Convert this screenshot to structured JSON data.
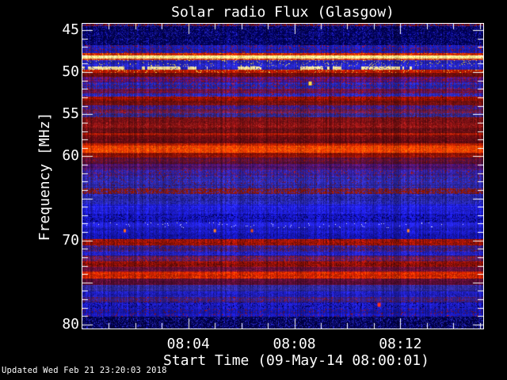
{
  "window": {
    "background": "#000000",
    "text_color": "#ffffff"
  },
  "chart_data": {
    "type": "heatmap",
    "subtype": "radio-spectrogram",
    "title": "Solar radio Flux (Glasgow)",
    "xlabel": "Start Time (09-May-14 08:00:01)",
    "ylabel": "Frequency [MHz]",
    "footer": "Updated Wed Feb 21 23:20:03 2018",
    "axis_color": "#ffffff",
    "background_color": "#000000",
    "x_range_minutes": [
      0,
      15.13
    ],
    "x_major_ticks": [
      {
        "minute": 4,
        "label": "08:04"
      },
      {
        "minute": 8,
        "label": "08:08"
      },
      {
        "minute": 12,
        "label": "08:12"
      }
    ],
    "x_minor_tick_every_minutes": 1,
    "y_range_mhz": [
      44.25,
      80.47
    ],
    "y_major_ticks": [
      {
        "mhz": 45,
        "label": "45"
      },
      {
        "mhz": 50,
        "label": "50"
      },
      {
        "mhz": 55,
        "label": "55"
      },
      {
        "mhz": 60,
        "label": "60"
      },
      {
        "mhz": 70,
        "label": "70"
      },
      {
        "mhz": 80,
        "label": "80"
      }
    ],
    "y_tick_marks_every_mhz": 1,
    "y_major_tick_every_mhz": 5,
    "bands_format": [
      "f0_mhz",
      "f1_mhz",
      "base_color",
      "fleck_color",
      "fleck_density",
      "optional_blocks_flag"
    ],
    "bands": [
      [
        44.25,
        44.55,
        "#7a1010",
        "#2a2a96",
        0.45
      ],
      [
        44.55,
        46.8,
        "#000050",
        "#1a1aa0",
        0.28
      ],
      [
        46.8,
        47.75,
        "#1d1db4",
        "#a01010",
        0.12
      ],
      [
        47.75,
        48.0,
        "#c32000",
        "#ff8000",
        0.15
      ],
      [
        48.0,
        48.35,
        "#fff2a0",
        "#ffc850",
        0.25
      ],
      [
        48.35,
        48.6,
        "#b42810",
        "#e08030",
        0.3
      ],
      [
        48.6,
        49.35,
        "#2424be",
        "#f0d040",
        0.06
      ],
      [
        49.35,
        49.75,
        "#2424be",
        "#f5e09a",
        0.0,
        "blocks"
      ],
      [
        49.75,
        50.1,
        "#bc1a00",
        "#ffd040",
        0.08
      ],
      [
        50.1,
        50.6,
        "#6e0c0c",
        "#8c1414",
        0.2
      ],
      [
        50.6,
        51.2,
        "#4a1482",
        "#a01010",
        0.2
      ],
      [
        51.2,
        52.0,
        "#2626b4",
        "#a81010",
        0.15
      ],
      [
        52.0,
        52.5,
        "#5a1456",
        "#8c1010",
        0.2
      ],
      [
        52.5,
        52.9,
        "#2a2ac0",
        "#901010",
        0.1
      ],
      [
        52.9,
        53.4,
        "#a81200",
        "#700808",
        0.2
      ],
      [
        53.4,
        53.9,
        "#6e0e0e",
        "#8c1818",
        0.2
      ],
      [
        53.9,
        54.4,
        "#381c92",
        "#8c1414",
        0.15
      ],
      [
        54.4,
        54.9,
        "#5a1e5a",
        "#a01414",
        0.2
      ],
      [
        54.9,
        55.35,
        "#2e2894",
        "#781414",
        0.15
      ],
      [
        55.35,
        56.1,
        "#700d12",
        "#8c1818",
        0.3
      ],
      [
        56.1,
        56.65,
        "#871010",
        "#a82020",
        0.3
      ],
      [
        56.65,
        57.2,
        "#640d12",
        "#801418",
        0.25
      ],
      [
        57.2,
        57.5,
        "#aa1604",
        "#c42810",
        0.2
      ],
      [
        57.5,
        57.9,
        "#700b10",
        "#8c1414",
        0.2
      ],
      [
        57.9,
        58.45,
        "#5c0a10",
        "#781018",
        0.2
      ],
      [
        58.45,
        58.75,
        "#b61c00",
        "#d43000",
        0.2
      ],
      [
        58.75,
        59.6,
        "#ee3800",
        "#ff6400",
        0.25
      ],
      [
        59.6,
        60.15,
        "#8e1004",
        "#a82010",
        0.2
      ],
      [
        60.15,
        60.9,
        "#55103c",
        "#801010",
        0.2
      ],
      [
        60.9,
        61.55,
        "#461270",
        "#6e1450",
        0.2
      ],
      [
        61.55,
        62.4,
        "#32209b",
        "#901414",
        0.12
      ],
      [
        62.4,
        63.8,
        "#2c28a8",
        "#781010",
        0.08
      ],
      [
        63.8,
        64.5,
        "#8c1608",
        "#3a2a9e",
        0.35
      ],
      [
        64.5,
        65.7,
        "#2a2ab0",
        "#14148c",
        0.2
      ],
      [
        65.7,
        66.8,
        "#1d1dd8",
        "#3030ff",
        0.15
      ],
      [
        66.8,
        67.9,
        "#1818c4",
        "#000060",
        0.2
      ],
      [
        67.9,
        68.5,
        "#2020cc",
        "#d8d8ff",
        0.02
      ],
      [
        68.5,
        69.2,
        "#1b1bc4",
        "#12129a",
        0.2
      ],
      [
        69.2,
        69.85,
        "#1717ba",
        "#0d0d8c",
        0.2
      ],
      [
        69.85,
        70.6,
        "#aa1606",
        "#6e0c0c",
        0.25
      ],
      [
        70.6,
        71.35,
        "#351f90",
        "#781010",
        0.12
      ],
      [
        71.35,
        71.8,
        "#2222c0",
        "#14149a",
        0.15
      ],
      [
        71.8,
        72.45,
        "#521a5e",
        "#a01616",
        0.2
      ],
      [
        72.45,
        73.1,
        "#9c1208",
        "#5e0a0a",
        0.25
      ],
      [
        73.1,
        73.7,
        "#651038",
        "#8c1446",
        0.2
      ],
      [
        73.7,
        74.5,
        "#cc2000",
        "#ff4800",
        0.2
      ],
      [
        74.5,
        75.3,
        "#560c32",
        "#701042",
        0.2
      ],
      [
        75.3,
        76.05,
        "#30289a",
        "#1e1e82",
        0.2
      ],
      [
        76.05,
        76.7,
        "#2020bc",
        "#141498",
        0.2
      ],
      [
        76.7,
        77.35,
        "#371f8c",
        "#8c1212",
        0.12
      ],
      [
        77.35,
        78.1,
        "#1c1cbe",
        "#000050",
        0.15
      ],
      [
        78.1,
        79.05,
        "#1818b0",
        "#8c1010",
        0.08
      ],
      [
        79.05,
        80.47,
        "#000047",
        "#2222aa",
        0.3
      ]
    ],
    "spots_format": [
      "minute",
      "mhz",
      "color",
      "size_px"
    ],
    "spots": [
      [
        8.6,
        51.3,
        "#ffdf40",
        4
      ],
      [
        11.2,
        77.6,
        "#ff3018",
        4
      ],
      [
        1.6,
        68.8,
        "#ff6a20",
        3
      ],
      [
        5.0,
        68.8,
        "#ff8428",
        3
      ],
      [
        6.4,
        68.8,
        "#e05018",
        3
      ],
      [
        12.3,
        68.8,
        "#ff8428",
        3
      ]
    ]
  }
}
